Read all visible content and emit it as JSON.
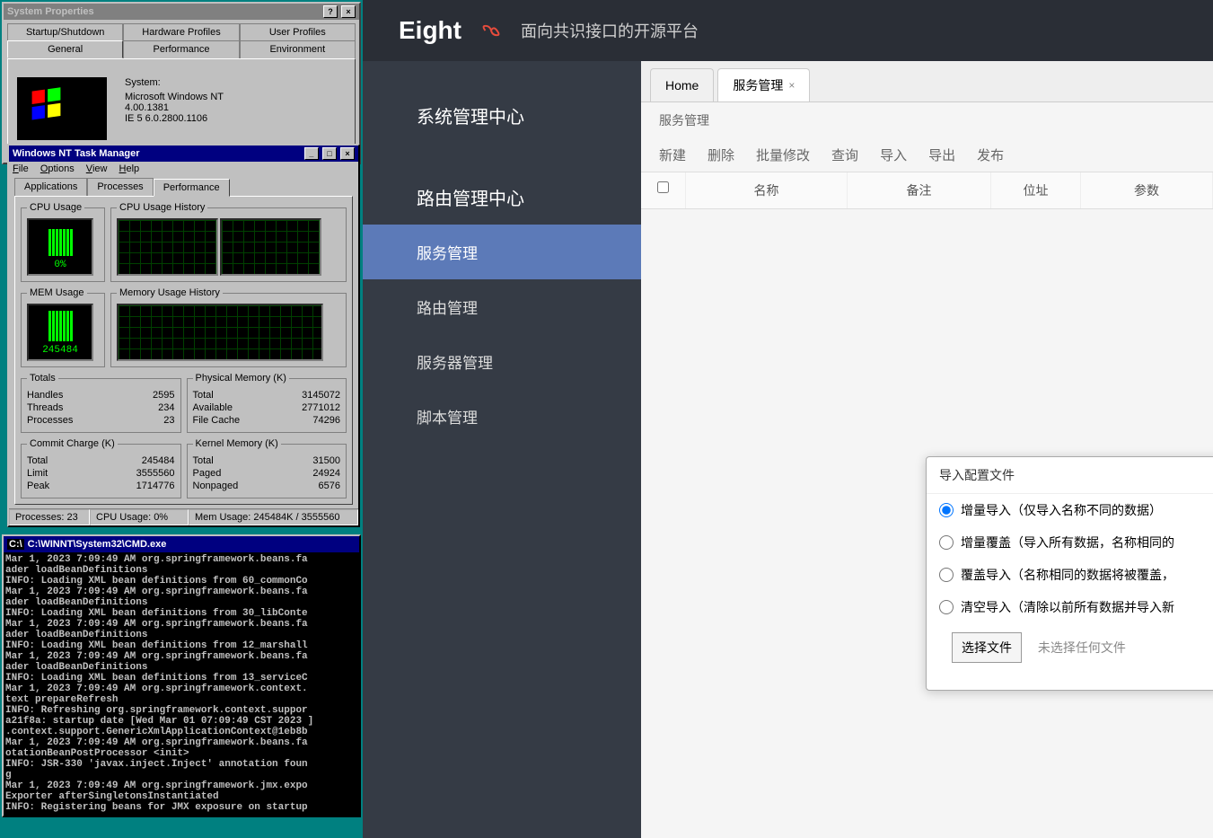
{
  "sysprops": {
    "title": "System Properties",
    "tabs_row1": [
      "Startup/Shutdown",
      "Hardware Profiles",
      "User Profiles"
    ],
    "tabs_row2": [
      "General",
      "Performance",
      "Environment"
    ],
    "system_label": "System:",
    "os": "Microsoft Windows NT",
    "ver": "4.00.1381",
    "ie": "IE 5 6.0.2800.1106"
  },
  "taskmgr": {
    "title": "Windows NT Task Manager",
    "menu": [
      "File",
      "Options",
      "View",
      "Help"
    ],
    "tabs": [
      "Applications",
      "Processes",
      "Performance"
    ],
    "cpu_label": "CPU Usage",
    "cpu_val": "0%",
    "cpuhist": "CPU Usage History",
    "mem_label": "MEM Usage",
    "mem_val": "245484",
    "memhist": "Memory Usage History",
    "totals": {
      "label": "Totals",
      "Handles": "2595",
      "Threads": "234",
      "Processes": "23"
    },
    "phys": {
      "label": "Physical Memory (K)",
      "Total": "3145072",
      "Available": "2771012",
      "File Cache": "74296"
    },
    "commit": {
      "label": "Commit Charge (K)",
      "Total": "245484",
      "Limit": "3555560",
      "Peak": "1714776"
    },
    "kernel": {
      "label": "Kernel Memory (K)",
      "Total": "31500",
      "Paged": "24924",
      "Nonpaged": "6576"
    },
    "status": [
      "Processes: 23",
      "CPU Usage: 0%",
      "Mem Usage: 245484K / 3555560"
    ]
  },
  "cmd": {
    "title": "C:\\WINNT\\System32\\CMD.exe",
    "text": "Mar 1, 2023 7:09:49 AM org.springframework.beans.fa\nader loadBeanDefinitions\nINFO: Loading XML bean definitions from 60_commonCo\nMar 1, 2023 7:09:49 AM org.springframework.beans.fa\nader loadBeanDefinitions\nINFO: Loading XML bean definitions from 30_libConte\nMar 1, 2023 7:09:49 AM org.springframework.beans.fa\nader loadBeanDefinitions\nINFO: Loading XML bean definitions from 12_marshall\nMar 1, 2023 7:09:49 AM org.springframework.beans.fa\nader loadBeanDefinitions\nINFO: Loading XML bean definitions from 13_serviceC\nMar 1, 2023 7:09:49 AM org.springframework.context.\ntext prepareRefresh\nINFO: Refreshing org.springframework.context.suppor\na21f8a: startup date [Wed Mar 01 07:09:49 CST 2023 ]\n.context.support.GenericXmlApplicationContext@1eb8b\nMar 1, 2023 7:09:49 AM org.springframework.beans.fa\notationBeanPostProcessor <init>\nINFO: JSR-330 'javax.inject.Inject' annotation foun\ng\nMar 1, 2023 7:09:49 AM org.springframework.jmx.expo\nExporter afterSingletonsInstantiated\nINFO: Registering beans for JMX exposure on startup"
  },
  "eight": {
    "brand": "Eight",
    "tagline": "面向共识接口的开源平台",
    "sidebar": {
      "h1": "系统管理中心",
      "h2": "路由管理中心",
      "items": [
        "服务管理",
        "路由管理",
        "服务器管理",
        "脚本管理"
      ]
    },
    "tabs": [
      {
        "label": "Home"
      },
      {
        "label": "服务管理"
      }
    ],
    "crumb": "服务管理",
    "toolbar": [
      "新建",
      "删除",
      "批量修改",
      "查询",
      "导入",
      "导出",
      "发布"
    ],
    "grid": [
      "名称",
      "备注",
      "位址",
      "参数"
    ]
  },
  "dialog": {
    "title": "导入配置文件",
    "opts": [
      "增量导入（仅导入名称不同的数据）",
      "增量覆盖（导入所有数据，名称相同的",
      "覆盖导入（名称相同的数据将被覆盖，",
      "清空导入（清除以前所有数据并导入新"
    ],
    "choose": "选择文件",
    "nofile": "未选择任何文件"
  }
}
